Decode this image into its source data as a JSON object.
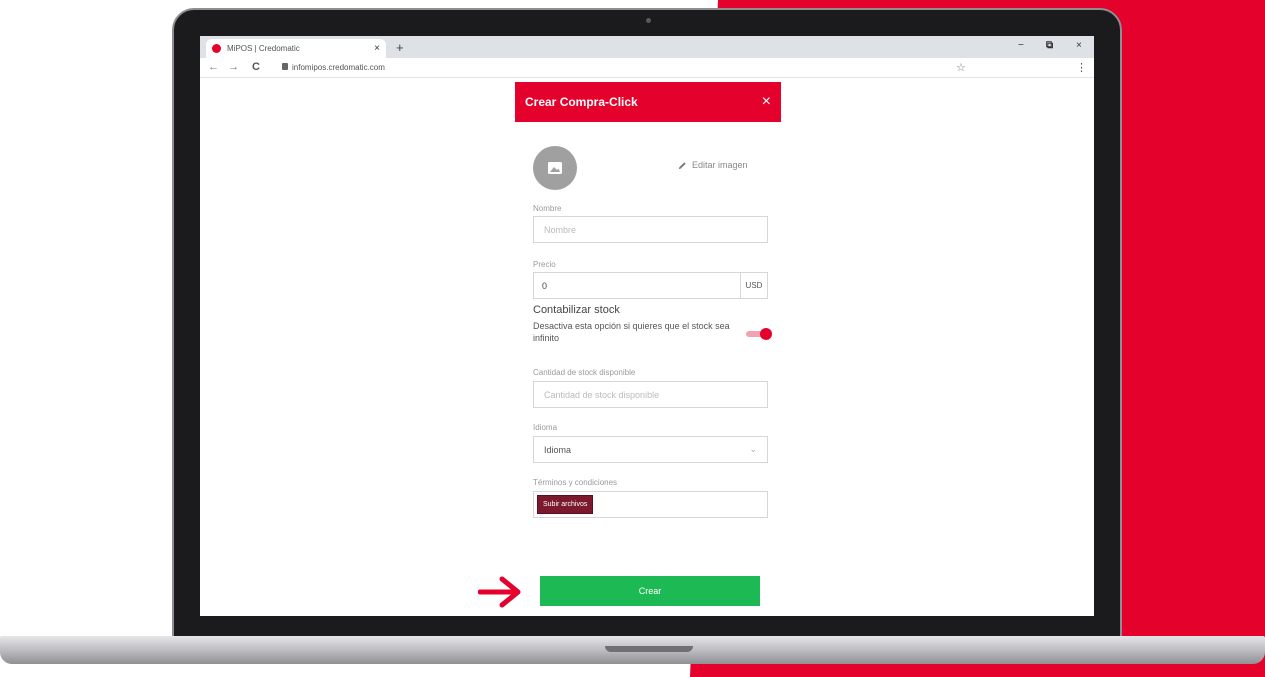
{
  "browser": {
    "tab_title": "MiPOS | Credomatic",
    "tab_close": "×",
    "new_tab": "+",
    "url": "infomipos.credomatic.com",
    "back": "←",
    "forward": "→",
    "reload": "C",
    "bookmark": "☆",
    "menu": "⋮",
    "minimize": "−",
    "maximize": "⧉",
    "close": "×"
  },
  "modal": {
    "title": "Crear Compra-Click",
    "close": "×",
    "edit_image": "Editar imagen",
    "name_label": "Nombre",
    "name_placeholder": "Nombre",
    "price_label": "Precio",
    "price_value": "0",
    "currency": "USD",
    "stock_title": "Contabilizar stock",
    "stock_desc": "Desactiva esta opción si quieres que el stock sea infinito",
    "stock_enabled": true,
    "stock_qty_label": "Cantidad de stock disponible",
    "stock_qty_placeholder": "Cantidad de stock disponible",
    "language_label": "Idioma",
    "language_value": "Idioma",
    "terms_label": "Términos y condiciones",
    "upload_label": "Subir archivos",
    "create_label": "Crear"
  },
  "colors": {
    "brand_red": "#e4022d",
    "create_green": "#1db954",
    "upload_maroon": "#7a1a2c"
  }
}
